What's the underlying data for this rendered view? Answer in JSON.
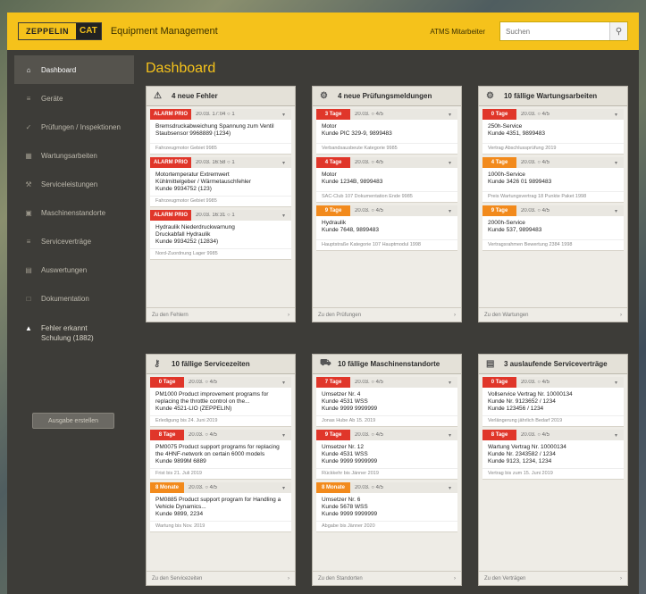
{
  "header": {
    "logo_left": "ZEPPELIN",
    "logo_cat": "CAT",
    "title": "Equipment Management",
    "user": "ATMS Mitarbeiter",
    "search_placeholder": "Suchen",
    "search_icon": "magnifier-icon"
  },
  "sidebar": {
    "items": [
      {
        "label": "Dashboard",
        "icon": "home-icon"
      },
      {
        "label": "Geräte",
        "icon": "list-icon"
      },
      {
        "label": "Prüfungen / Inspektionen",
        "icon": "check-icon"
      },
      {
        "label": "Wartungsarbeiten",
        "icon": "calendar-icon"
      },
      {
        "label": "Serviceleistungen",
        "icon": "wrench-icon"
      },
      {
        "label": "Maschinenstandorte",
        "icon": "truck-icon"
      },
      {
        "label": "Serviceverträge",
        "icon": "list-icon"
      },
      {
        "label": "Auswertungen",
        "icon": "chart-icon"
      },
      {
        "label": "Dokumentation",
        "icon": "doc-icon"
      }
    ],
    "extra": {
      "line1": "Fehler erkannt",
      "line2": "Schulung (1882)"
    },
    "button": "Ausgabe erstellen"
  },
  "page_title": "Dashboard",
  "panels": [
    {
      "title": "4 neue Fehler",
      "icon": "warning-icon",
      "entries": [
        {
          "badge": "ALARM PRIO",
          "color": "red",
          "meta": "20.03. 17:04   ○ 1",
          "text": "Bremsdruckabweichung Spannung zum Ventil\nStaubsensor 9968889 (1234)",
          "foot": "Fahrzeugmotor Gebiet 9985"
        },
        {
          "badge": "ALARM PRIO",
          "color": "red",
          "meta": "20.03. 16:58   ○ 1",
          "text": "Motortemperatur Extremwert\nKühlmittelgeber / Wärmetauschfehler\nKunde 9934752 (123)",
          "foot": "Fahrzeugmotor Gebiet 9985"
        },
        {
          "badge": "ALARM PRIO",
          "color": "red",
          "meta": "20.03. 16:31   ○ 1",
          "text": "Hydraulik Niederdruckwarnung\nDruckabfall Hydraulik\nKunde 9934252 (12834)",
          "foot": "Nord-Zuordnung Lager 9985"
        }
      ],
      "footer": "Zu den Fehlern"
    },
    {
      "title": "4 neue Prüfungsmeldungen",
      "icon": "gear-icon",
      "entries": [
        {
          "badge": "3 Tage",
          "color": "red",
          "meta": "20.03.   ○ 4/5",
          "text": "Motor\nKunde PIC 329-9, 9899483",
          "foot": "Verbandsausbeute Kategorie 9985"
        },
        {
          "badge": "4 Tage",
          "color": "red",
          "meta": "20.03.   ○ 4/5",
          "text": "Motor\nKunde 1234B, 9899483",
          "foot": "SAC-Club 107 Dokumentation Ende 9985"
        },
        {
          "badge": "9 Tage",
          "color": "orange",
          "meta": "20.03.   ○ 4/5",
          "text": "Hydraulik\nKunde 7648, 9899483",
          "foot": "Hauptstraße Kategorie 107 Hauptmodul 1998"
        }
      ],
      "footer": "Zu den Prüfungen"
    },
    {
      "title": "10 fällige Wartungsarbeiten",
      "icon": "wrench-icon",
      "entries": [
        {
          "badge": "0 Tage",
          "color": "red",
          "meta": "20.03.   ○ 4/5",
          "text": "250h-Service\nKunde 4351, 9899483",
          "foot": "Vertrag Abschlussprüfung 2019"
        },
        {
          "badge": "4 Tage",
          "color": "orange",
          "meta": "20.03.   ○ 4/5",
          "text": "1000h-Service\nKunde 3426 01 9899483",
          "foot": "Preis Wartungsvertrag 18 Punkte Paket 1998"
        },
        {
          "badge": "9 Tage",
          "color": "orange",
          "meta": "20.03.   ○ 4/5",
          "text": "2000h-Service\nKunde 537, 9899483",
          "foot": "Vertragsrahmen Bewertung 2384 1998"
        }
      ],
      "footer": "Zu den Wartungen"
    },
    {
      "title": "10 fällige Servicezeiten",
      "icon": "key-icon",
      "entries": [
        {
          "badge": "0 Tage",
          "color": "red",
          "meta": "20.03.   ○ 4/5",
          "text": "PM1000 Product improvement programs for replacing the throttle control on the...\nKunde 4521-LIO (ZEPPELIN)",
          "foot": "Erledigung bis 24. Juni 2019"
        },
        {
          "badge": "8 Tage",
          "color": "red",
          "meta": "20.03.   ○ 4/5",
          "text": "PM0075 Product support programs for replacing the 4HNF-network on certain 6000 models\nKunde 9899M 6889",
          "foot": "Frist bis 21. Juli 2019"
        },
        {
          "badge": "8 Monate",
          "color": "orange",
          "meta": "20.03.   ○ 4/5",
          "text": "PM0885 Product support program for Handling a Vehicle Dynamics...\nKunde 9899, 2234",
          "foot": "Wartung bis Nov. 2019"
        }
      ],
      "footer": "Zu den Servicezeiten"
    },
    {
      "title": "10 fällige Maschinenstandorte",
      "icon": "truck-icon",
      "entries": [
        {
          "badge": "7 Tage",
          "color": "red",
          "meta": "20.03.   ○ 4/5",
          "text": "Umsetzer Nr. 4\nKunde 4531 WSS\nKunde 9999 9999999",
          "foot": "Jonas Hube Ab 15. 2019"
        },
        {
          "badge": "9 Tage",
          "color": "red",
          "meta": "20.03.   ○ 4/5",
          "text": "Umsetzer Nr. 12\nKunde 4531 WSS\nKunde 9999 9999999",
          "foot": "Rückkehr bis Jänner 2019"
        },
        {
          "badge": "8 Monate",
          "color": "orange",
          "meta": "20.03.   ○ 4/5",
          "text": "Umsetzer Nr. 6\nKunde 5678 WSS\nKunde 9999 9999999",
          "foot": "Abgabe bis Jänner 2020"
        }
      ],
      "footer": "Zu den Standorten"
    },
    {
      "title": "3 auslaufende Serviceverträge",
      "icon": "doc-icon",
      "entries": [
        {
          "badge": "0 Tage",
          "color": "red",
          "meta": "20.03.   ○ 4/5",
          "text": "Vollservice Vertrag Nr. 10000134\nKunde Nr. 9123652 / 1234\nKunde 123456 / 1234",
          "foot": "Verlängerung jährlich Bedarf 2019"
        },
        {
          "badge": "8 Tage",
          "color": "red",
          "meta": "20.03.   ○ 4/5",
          "text": "Wartung Vertrag Nr. 10000134\nKunde Nr. 2343582 / 1234\nKunde 9123, 1234, 1234",
          "foot": "Vertrag bis zum 15. Juni 2019"
        }
      ],
      "footer": "Zu den Verträgen"
    }
  ]
}
